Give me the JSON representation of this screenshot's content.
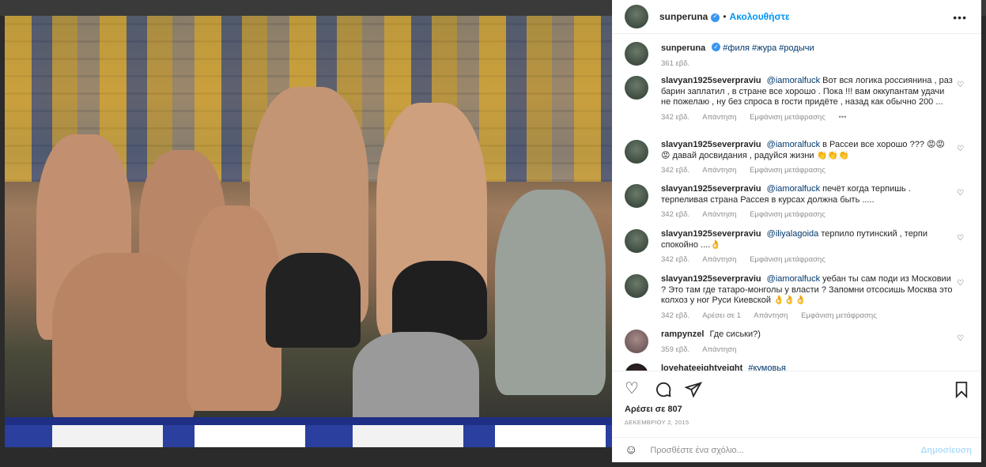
{
  "header": {
    "username": "sunperuna",
    "verified": true,
    "separator": "•",
    "follow_label": "Ακολουθήστε",
    "more_icon": "more-horizontal-icon"
  },
  "caption": {
    "username": "sunperuna",
    "text": "#филя #жура #родычи",
    "time": "361 εβδ."
  },
  "comments": [
    {
      "username": "slavyan1925severpraviu",
      "mention": "@iamoralfuck",
      "text": "Вот вся логика россиянина , раз барин заплатил , в стране все хорошо . Пока !!! вам оккупантам удачи не пожелаю , ну без спроса в гости придёте , назад как обычно 200 ...",
      "time": "342 εβδ.",
      "reply": "Απάντηση",
      "translate": "Εμφάνιση μετάφρασης",
      "options": "•••"
    },
    {
      "username": "slavyan1925severpraviu",
      "mention": "@iamoralfuck",
      "text": "в Рассеи все хорошо ??? 😡😡😡 давай досвидания , радуйся жизни 👏👏👏",
      "time": "342 εβδ.",
      "reply": "Απάντηση",
      "translate": "Εμφάνιση μετάφρασης"
    },
    {
      "username": "slavyan1925severpraviu",
      "mention": "@iamoralfuck",
      "text": "печёт когда терпишь . терпеливая страна Рассея в курсах должна быть .....",
      "time": "342 εβδ.",
      "reply": "Απάντηση",
      "translate": "Εμφάνιση μετάφρασης"
    },
    {
      "username": "slavyan1925severpraviu",
      "mention": "@iliyalagoida",
      "text": "терпило путинский , терпи спокойно ....👌",
      "time": "342 εβδ.",
      "reply": "Απάντηση",
      "translate": "Εμφάνιση μετάφρασης"
    },
    {
      "username": "slavyan1925severpraviu",
      "mention": "@iamoralfuck",
      "text": "уебан ты сам поди из Московии ? Это там где татаро-монголы у власти ? Запомни отсосишь Москва это колхоз у ног Руси Киевской 👌👌👌",
      "time": "342 εβδ.",
      "likes": "Αρέσει σε 1",
      "reply": "Απάντηση",
      "translate": "Εμφάνιση μετάφρασης"
    },
    {
      "username": "rampynzel",
      "mention": "",
      "text": "Где сиськи?)",
      "time": "359 εβδ.",
      "reply": "Απάντηση"
    },
    {
      "username": "lovehateeightyeight",
      "mention": "",
      "text": "#кумовья"
    }
  ],
  "actions": {
    "like_icon": "heart-icon",
    "comment_icon": "comment-icon",
    "share_icon": "send-icon",
    "save_icon": "bookmark-icon",
    "likes_text": "Αρέσει σε 807",
    "date": "ΔΕΚΕΜΒΡΙΟΥ 2, 2015"
  },
  "add_comment": {
    "emoji_icon": "emoji-smile-icon",
    "placeholder": "Προσθέστε ένα σχόλιο...",
    "post_label": "Δημοσίευση"
  },
  "colors": {
    "accent": "#0095f6",
    "link": "#00376b",
    "muted": "#8e8e8e"
  }
}
